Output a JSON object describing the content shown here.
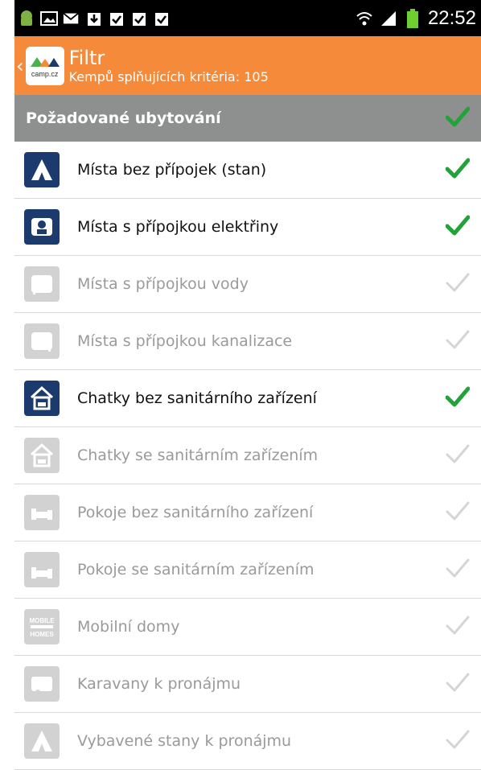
{
  "statusbar": {
    "time": "22:52"
  },
  "actionbar": {
    "logo_text": "camp.cz",
    "title": "Filtr",
    "subtitle": "Kempů splňujících kritéria: 105"
  },
  "section": {
    "title": "Požadované ubytování",
    "checked": true
  },
  "items": [
    {
      "label": "Místa bez přípojek (stan)",
      "checked": true,
      "icon": "tent-icon"
    },
    {
      "label": "Místa s přípojkou elektřiny",
      "checked": true,
      "icon": "electricity-hookup-icon"
    },
    {
      "label": "Místa s přípojkou vody",
      "checked": false,
      "icon": "water-hookup-icon"
    },
    {
      "label": "Místa s přípojkou kanalizace",
      "checked": false,
      "icon": "sewer-hookup-icon"
    },
    {
      "label": "Chatky bez sanitárního zařízení",
      "checked": true,
      "icon": "cabin-icon"
    },
    {
      "label": "Chatky se sanitárním zařízením",
      "checked": false,
      "icon": "cabin-wc-icon"
    },
    {
      "label": "Pokoje bez sanitárního zařízení",
      "checked": false,
      "icon": "room-bed-icon"
    },
    {
      "label": "Pokoje se sanitárním zařízením",
      "checked": false,
      "icon": "room-wc-icon"
    },
    {
      "label": "Mobilní domy",
      "checked": false,
      "icon": "mobile-homes-icon",
      "icon_text": [
        "MOBILE",
        "HOMES"
      ]
    },
    {
      "label": "Karavany k pronájmu",
      "checked": false,
      "icon": "caravan-icon"
    },
    {
      "label": "Vybavené stany k pronájmu",
      "checked": false,
      "icon": "equipped-tent-icon"
    }
  ],
  "colors": {
    "actionbar": "#f58a3a",
    "section": "#8e9090",
    "icon_active": "#1b3a6e",
    "icon_inactive": "#d2d2d2",
    "check_active": "#22a33a",
    "check_inactive": "#d5d5d5"
  }
}
